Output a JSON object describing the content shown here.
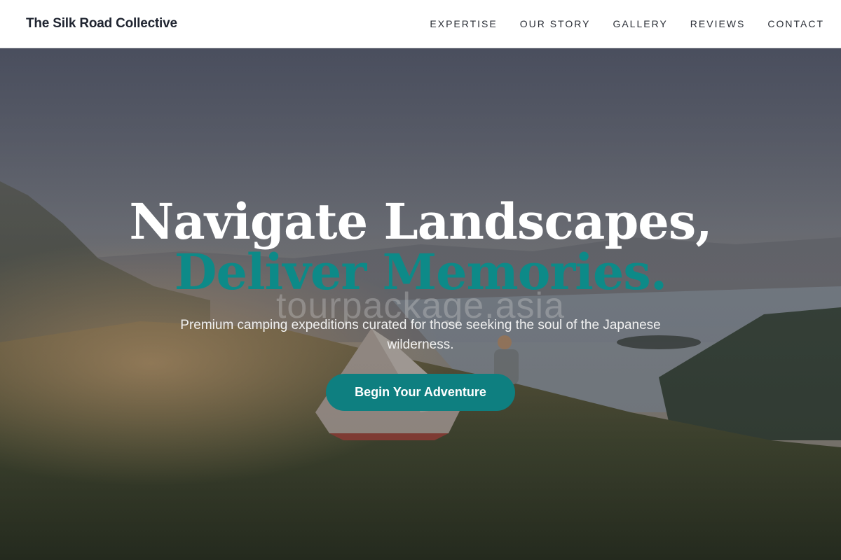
{
  "brand": {
    "name": "The Silk Road Collective"
  },
  "nav": {
    "items": [
      {
        "label": "EXPERTISE"
      },
      {
        "label": "OUR STORY"
      },
      {
        "label": "GALLERY"
      },
      {
        "label": "REVIEWS"
      },
      {
        "label": "CONTACT"
      }
    ]
  },
  "hero": {
    "headline_line1": "Navigate Landscapes,",
    "headline_line2": "Deliver Memories.",
    "watermark": "tourpackage.asia",
    "subtitle": "Premium camping expeditions curated for those seeking the soul of the Japanese wilderness.",
    "cta_label": "Begin Your Adventure"
  },
  "colors": {
    "accent": "#0d8a88",
    "cta_background": "#0e7f80",
    "brand_text": "#1f2430"
  }
}
